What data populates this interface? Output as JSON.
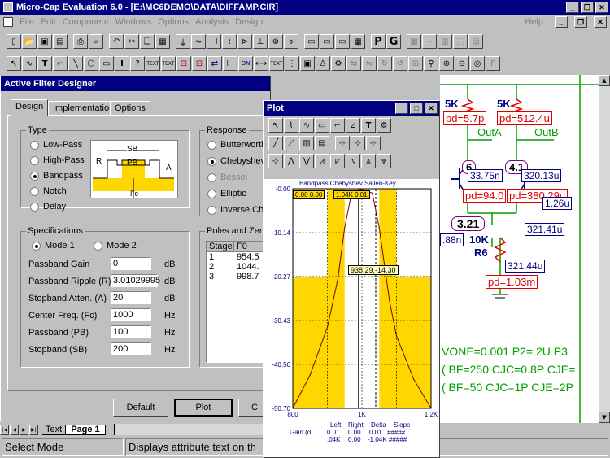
{
  "app": {
    "title": "Micro-Cap Evaluation 6.0 - [E:\\MC6DEMO\\DATA\\DIFFAMP.CIR]",
    "menus": [
      "File",
      "Edit",
      "Component",
      "Windows",
      "Options",
      "Analysis",
      "Design"
    ],
    "help": "Help"
  },
  "toolbar1": {
    "P": "P",
    "G": "G"
  },
  "toolbar2": {
    "text1": "TEXT",
    "text2": "TEXT",
    "text3": "TEXT",
    "on": "ON"
  },
  "schematic": {
    "r1": "5K",
    "r2": "5K",
    "pd1": "pd=5.7p",
    "pd2": "pd=512.4u",
    "outA": "OutA",
    "outB": "OutB",
    "node1": "6",
    "node2": "4.1",
    "v1": "33.75n",
    "v2": "320.13u",
    "pd3": "pd=94.0",
    "pd4": "pd=380.29u",
    "v3": "1.26u",
    "node3": "3.21",
    "v4": "321.41u",
    "v5": ".88n",
    "r3": "10K",
    "r6": "R6",
    "v6": "321.44u",
    "pd5": "pd=1.03m",
    "line1": "VONE=0.001 P2=.2U P3",
    "line2": "( BF=250 CJC=0.8P CJE=",
    "line3": "( BF=50 CJC=1P CJE=2P"
  },
  "dialog": {
    "title": "Active Filter Designer",
    "tabs": [
      "Design",
      "Implementation",
      "Options"
    ],
    "type_label": "Type",
    "types": [
      {
        "label": "Low-Pass",
        "on": false
      },
      {
        "label": "High-Pass",
        "on": false
      },
      {
        "label": "Bandpass",
        "on": true
      },
      {
        "label": "Notch",
        "on": false
      },
      {
        "label": "Delay",
        "on": false
      }
    ],
    "diagram": {
      "sb": "SB",
      "pb": "PB",
      "r": "R",
      "a": "A",
      "fc": "Fc"
    },
    "response_label": "Response",
    "responses": [
      {
        "label": "Butterworth",
        "on": false,
        "dim": false
      },
      {
        "label": "Chebyshev",
        "on": true,
        "dim": false
      },
      {
        "label": "Bessel",
        "on": false,
        "dim": true
      },
      {
        "label": "Elliptic",
        "on": false,
        "dim": false
      },
      {
        "label": "Inverse Che",
        "on": false,
        "dim": false
      }
    ],
    "spec_label": "Specifications",
    "mode1": "Mode 1",
    "mode2": "Mode 2",
    "specs": [
      {
        "label": "Passband Gain",
        "value": "0",
        "unit": "dB"
      },
      {
        "label": "Passband Ripple (R)",
        "value": "3.01029995",
        "unit": "dB"
      },
      {
        "label": "Stopband Atten. (A)",
        "value": "20",
        "unit": "dB"
      },
      {
        "label": "Center Freq. (Fc)",
        "value": "1000",
        "unit": "Hz"
      },
      {
        "label": "Passband (PB)",
        "value": "100",
        "unit": "Hz"
      },
      {
        "label": "Stopband (SB)",
        "value": "200",
        "unit": "Hz"
      }
    ],
    "poles_label": "Poles and Zeros",
    "poles_headers": [
      "Stage",
      "F0"
    ],
    "poles_rows": [
      [
        "1",
        "954.5"
      ],
      [
        "2",
        "1044."
      ],
      [
        "3",
        "998.7"
      ]
    ],
    "default_btn": "Default",
    "plot_btn": "Plot",
    "cut_btn": "C"
  },
  "tabsbar": {
    "t1": "Text",
    "t2": "Page 1"
  },
  "status": {
    "mode": "Select Mode",
    "msg": "Displays attribute text on th"
  },
  "plot": {
    "title": "Plot",
    "chart_title": "Bandpass Chebyshev Sallen-Key",
    "yticks": [
      "-0.00",
      "-10.14",
      "-20.27",
      "-30.43",
      "-40.56",
      "-50.70"
    ],
    "xticks": [
      "800",
      "1K",
      "1.2K"
    ],
    "cursor1": "0.00 0.00",
    "cursor2": "1.04K 0.01",
    "point_label": "938.29,-14.30",
    "table_headers": [
      "Left",
      "Right",
      "Delta",
      "Slope"
    ],
    "row_label": "Gain (d",
    "row1": [
      "0.01",
      "0.00",
      "0.01",
      "#####"
    ],
    "row2": [
      ".04K",
      "0.00",
      "-1.04K",
      "#####"
    ]
  },
  "chart_data": {
    "type": "line",
    "title": "Bandpass Chebyshev Sallen-Key",
    "xlabel": "",
    "ylabel": "Gain (d",
    "xlim": [
      800,
      1200
    ],
    "ylim": [
      -50.7,
      0
    ],
    "series": [
      {
        "x": [
          800,
          850,
          900,
          930,
          950,
          970,
          990,
          1000,
          1010,
          1030,
          1050,
          1080,
          1100,
          1150,
          1200
        ],
        "values": [
          -50.7,
          -43,
          -32,
          -21,
          -9,
          -1,
          -0.4,
          -0.01,
          -0.4,
          -1,
          -9,
          -26,
          -34,
          -44,
          -50.7
        ]
      }
    ]
  }
}
